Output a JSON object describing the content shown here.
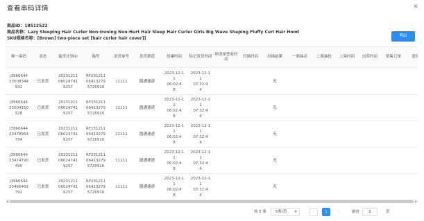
{
  "dialog": {
    "title": "查看串码详情",
    "close_icon": "close-icon"
  },
  "product": {
    "id_line": "商品ID：18512522",
    "name_line": "商品名称：Lazy Sleeping Hair Curler Non-Ironing Non-Hurt Hair Sleep Hair Curler Girls Big Wave Shaping Fluffy Curl Hair Hood",
    "sku_line": "SKU规格名称：[Brown] two-piece set [hair curler hair cover]]"
  },
  "export_label": "导出",
  "table": {
    "headers": [
      "唯一串码",
      "状态",
      "备货计划ID",
      "箱号",
      "发货单号",
      "发货渠道",
      "创建时间",
      "标记发货时间",
      "物流单签收时间",
      "扫描时间",
      "扫描结果",
      "一面抽点",
      "二面抽检",
      "上架时间",
      "出库时间",
      "销售订单",
      "退货"
    ],
    "rows": [
      {
        "code": "J3966644 23508344 932",
        "status": "已发货",
        "plan": "20231211 06024741 9257",
        "box": "RF231211 06413279 5726916",
        "ship_no": "11111",
        "channel": "圆通速递",
        "created": "2023-12-1 1 06:02:4 8",
        "marked": "2023-12-1 1 07:32:4 4",
        "signed": "",
        "scan_time": "",
        "scan_result": "无"
      },
      {
        "code": "J3966644 23504150 528",
        "status": "已发货",
        "plan": "20231211 06024741 9257",
        "box": "RF231211 06413279 5726916",
        "ship_no": "11111",
        "channel": "圆通速递",
        "created": "2023-12-1 1 06:02:4 8",
        "marked": "2023-12-1 1 07:32:4 4",
        "signed": "",
        "scan_time": "",
        "scan_result": "无"
      },
      {
        "code": "J3966644 23478964 704",
        "status": "已发货",
        "plan": "20231211 06024741 9257",
        "box": "RF231211 06413279 5726916",
        "ship_no": "11111",
        "channel": "圆通速递",
        "created": "2023-12-1 1 06:02:4 8",
        "marked": "2023-12-1 1 07:32:4 4",
        "signed": "",
        "scan_time": "",
        "scan_result": "无"
      },
      {
        "code": "J3966644 23474790 400",
        "status": "已发货",
        "plan": "20231211 06024741 9257",
        "box": "RF231211 06413279 5726916",
        "ship_no": "11111",
        "channel": "圆通速递",
        "created": "2023-12-1 1 06:02:4 8",
        "marked": "2023-12-1 1 07:32:4 4",
        "signed": "",
        "scan_time": "",
        "scan_result": "无"
      },
      {
        "code": "J3966644 23466401 792",
        "status": "已发货",
        "plan": "20231211 06024741 9257",
        "box": "RF231211 06413279 5726916",
        "ship_no": "11111",
        "channel": "圆通速递",
        "created": "2023-12-1 1 06:02:4 8",
        "marked": "2023-12-1 1 07:32:4 4",
        "signed": "",
        "scan_time": "",
        "scan_result": "无"
      }
    ]
  },
  "pagination": {
    "total": "共 5 条",
    "page_size": "5条/页",
    "prev_icon": "chevron-left-icon",
    "current_page": "1",
    "next_icon": "chevron-right-icon",
    "jump_prefix": "前往",
    "jump_value": "1",
    "jump_suffix": "页"
  }
}
